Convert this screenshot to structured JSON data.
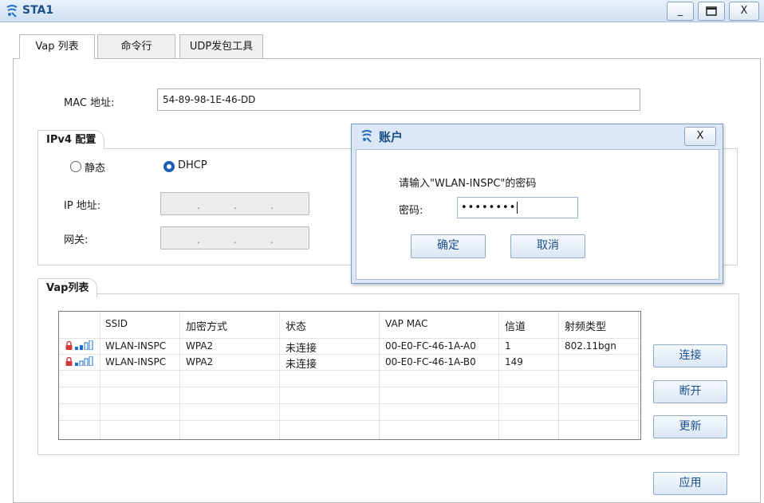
{
  "window": {
    "title": "STA1",
    "min_label": "_",
    "max_label": "□",
    "close_label": "X"
  },
  "tabs": [
    {
      "label": "Vap 列表"
    },
    {
      "label": "命令行"
    },
    {
      "label": "UDP发包工具"
    }
  ],
  "mac": {
    "label": "MAC 地址:",
    "value": "54-89-98-1E-46-DD"
  },
  "ipv4": {
    "group_title": "IPv4 配置",
    "static_label": "静态",
    "dhcp_label": "DHCP",
    "selected": "DHCP",
    "ip_label": "IP 地址:",
    "gateway_label": "网关:",
    "ip_dots": [
      ".",
      ".",
      "."
    ],
    "gw_dots": [
      ".",
      ".",
      "."
    ]
  },
  "vap": {
    "group_title": "Vap列表",
    "columns": [
      "SSID",
      "加密方式",
      "状态",
      "VAP MAC",
      "信道",
      "射频类型"
    ],
    "rows": [
      {
        "ssid": "WLAN-INSPC",
        "encryption": "WPA2",
        "status": "未连接",
        "vap_mac": "00-E0-FC-46-1A-A0",
        "channel": "1",
        "radio": "802.11bgn"
      },
      {
        "ssid": "WLAN-INSPC",
        "encryption": "WPA2",
        "status": "未连接",
        "vap_mac": "00-E0-FC-46-1A-B0",
        "channel": "149",
        "radio": ""
      }
    ],
    "buttons": {
      "connect": "连接",
      "disconnect": "断开",
      "refresh": "更新"
    }
  },
  "apply_label": "应用",
  "dialog": {
    "title": "账户",
    "close_label": "X",
    "prompt": "请输入\"WLAN-INSPC\"的密码",
    "password_label": "密码:",
    "password_value": "••••••••",
    "ok_label": "确定",
    "cancel_label": "取消"
  },
  "colors": {
    "accent": "#1e5fb4",
    "title_text": "#1b4f8a",
    "lock": "#d23a3a",
    "signal": "#1e6fd0"
  }
}
